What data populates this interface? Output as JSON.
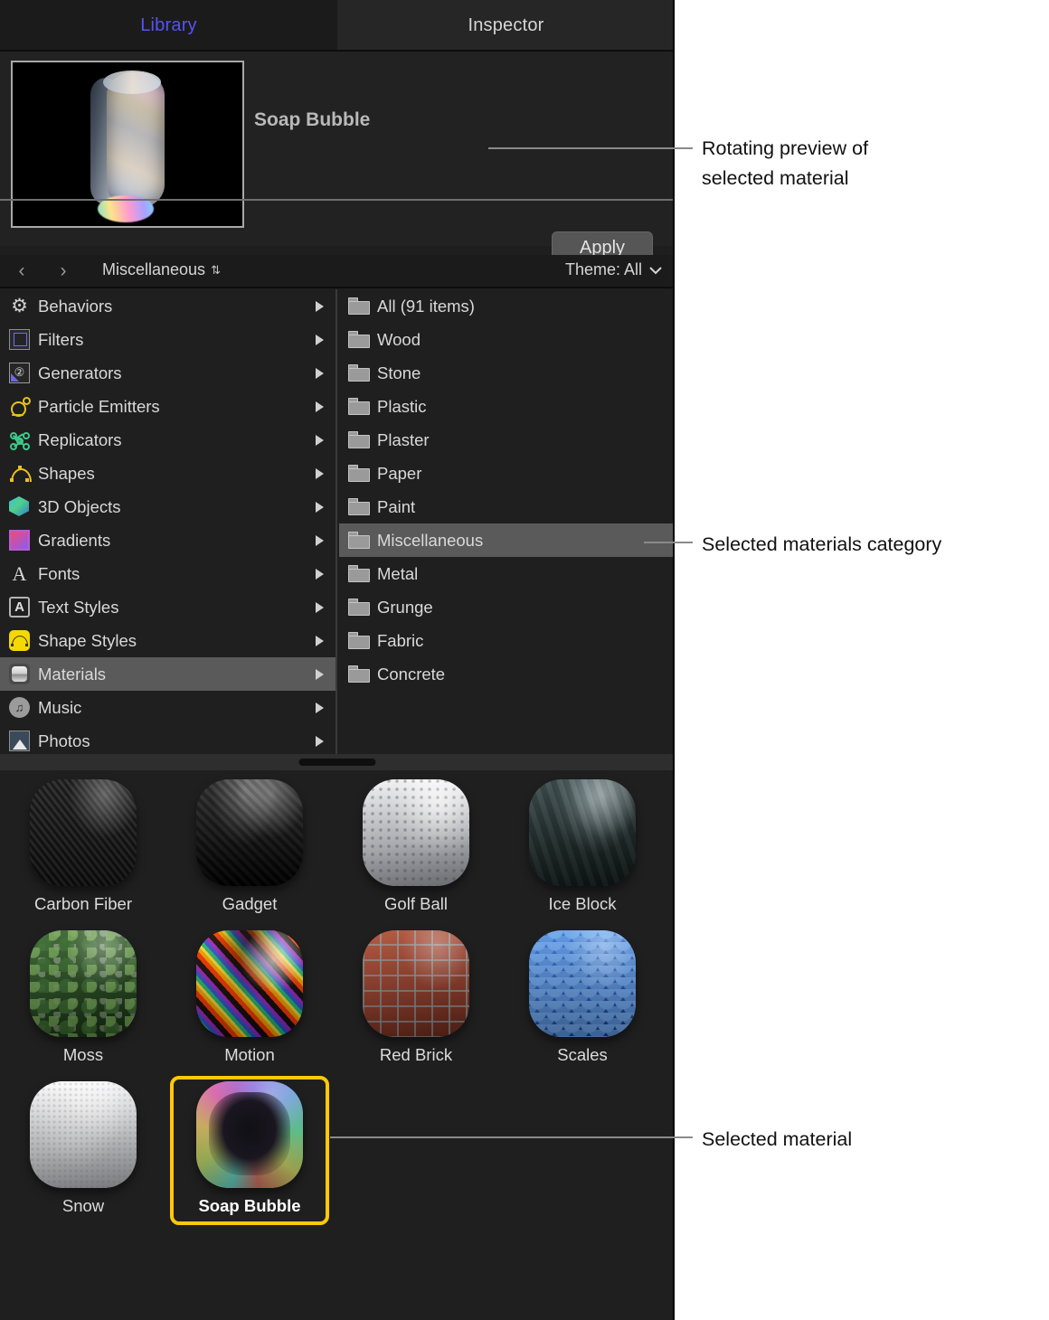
{
  "tabs": [
    {
      "label": "Library",
      "selected": true
    },
    {
      "label": "Inspector",
      "selected": false
    }
  ],
  "preview": {
    "title": "Soap Bubble",
    "apply_label": "Apply"
  },
  "navbar": {
    "back_glyph": "‹",
    "forward_glyph": "›",
    "path_label": "Miscellaneous",
    "sort_glyph": "⇅",
    "theme_label": "Theme: All",
    "theme_chevron": "⌄"
  },
  "categories": [
    {
      "label": "Behaviors",
      "icon": "gear-icon",
      "selected": false
    },
    {
      "label": "Filters",
      "icon": "film-strip-icon",
      "selected": false
    },
    {
      "label": "Generators",
      "icon": "generator-icon",
      "selected": false
    },
    {
      "label": "Particle Emitters",
      "icon": "particle-emitter-icon",
      "selected": false
    },
    {
      "label": "Replicators",
      "icon": "replicator-icon",
      "selected": false
    },
    {
      "label": "Shapes",
      "icon": "shape-curve-icon",
      "selected": false
    },
    {
      "label": "3D Objects",
      "icon": "cube-icon",
      "selected": false
    },
    {
      "label": "Gradients",
      "icon": "gradient-swatch-icon",
      "selected": false
    },
    {
      "label": "Fonts",
      "icon": "letter-a-icon",
      "selected": false
    },
    {
      "label": "Text Styles",
      "icon": "text-style-icon",
      "selected": false
    },
    {
      "label": "Shape Styles",
      "icon": "shape-style-icon",
      "selected": false
    },
    {
      "label": "Materials",
      "icon": "material-sphere-icon",
      "selected": true
    },
    {
      "label": "Music",
      "icon": "music-note-icon",
      "selected": false
    },
    {
      "label": "Photos",
      "icon": "photo-icon",
      "selected": false
    }
  ],
  "folders": [
    {
      "label": "All (91 items)",
      "selected": false
    },
    {
      "label": "Wood",
      "selected": false
    },
    {
      "label": "Stone",
      "selected": false
    },
    {
      "label": "Plastic",
      "selected": false
    },
    {
      "label": "Plaster",
      "selected": false
    },
    {
      "label": "Paper",
      "selected": false
    },
    {
      "label": "Paint",
      "selected": false
    },
    {
      "label": "Miscellaneous",
      "selected": true
    },
    {
      "label": "Metal",
      "selected": false
    },
    {
      "label": "Grunge",
      "selected": false
    },
    {
      "label": "Fabric",
      "selected": false
    },
    {
      "label": "Concrete",
      "selected": false
    }
  ],
  "materials": [
    {
      "label": "Carbon Fiber",
      "swatch": "m-carbon",
      "selected": false
    },
    {
      "label": "Gadget",
      "swatch": "m-gadget",
      "selected": false
    },
    {
      "label": "Golf Ball",
      "swatch": "m-golf",
      "selected": false
    },
    {
      "label": "Ice Block",
      "swatch": "m-ice",
      "selected": false
    },
    {
      "label": "Moss",
      "swatch": "m-moss",
      "selected": false
    },
    {
      "label": "Motion",
      "swatch": "m-motion",
      "selected": false
    },
    {
      "label": "Red Brick",
      "swatch": "m-brick",
      "selected": false
    },
    {
      "label": "Scales",
      "swatch": "m-scales",
      "selected": false
    },
    {
      "label": "Snow",
      "swatch": "m-snow",
      "selected": false
    },
    {
      "label": "Soap Bubble",
      "swatch": "m-soap",
      "selected": true
    }
  ],
  "annotations": [
    {
      "text": "Rotating preview of\nselected material"
    },
    {
      "text": "Selected materials category"
    },
    {
      "text": "Selected material"
    }
  ],
  "colors": {
    "accent_tab": "#5554f4",
    "selection_highlight": "#ffc907",
    "row_selection": "#5a5a5a",
    "panel_background": "#1f1f1f"
  }
}
